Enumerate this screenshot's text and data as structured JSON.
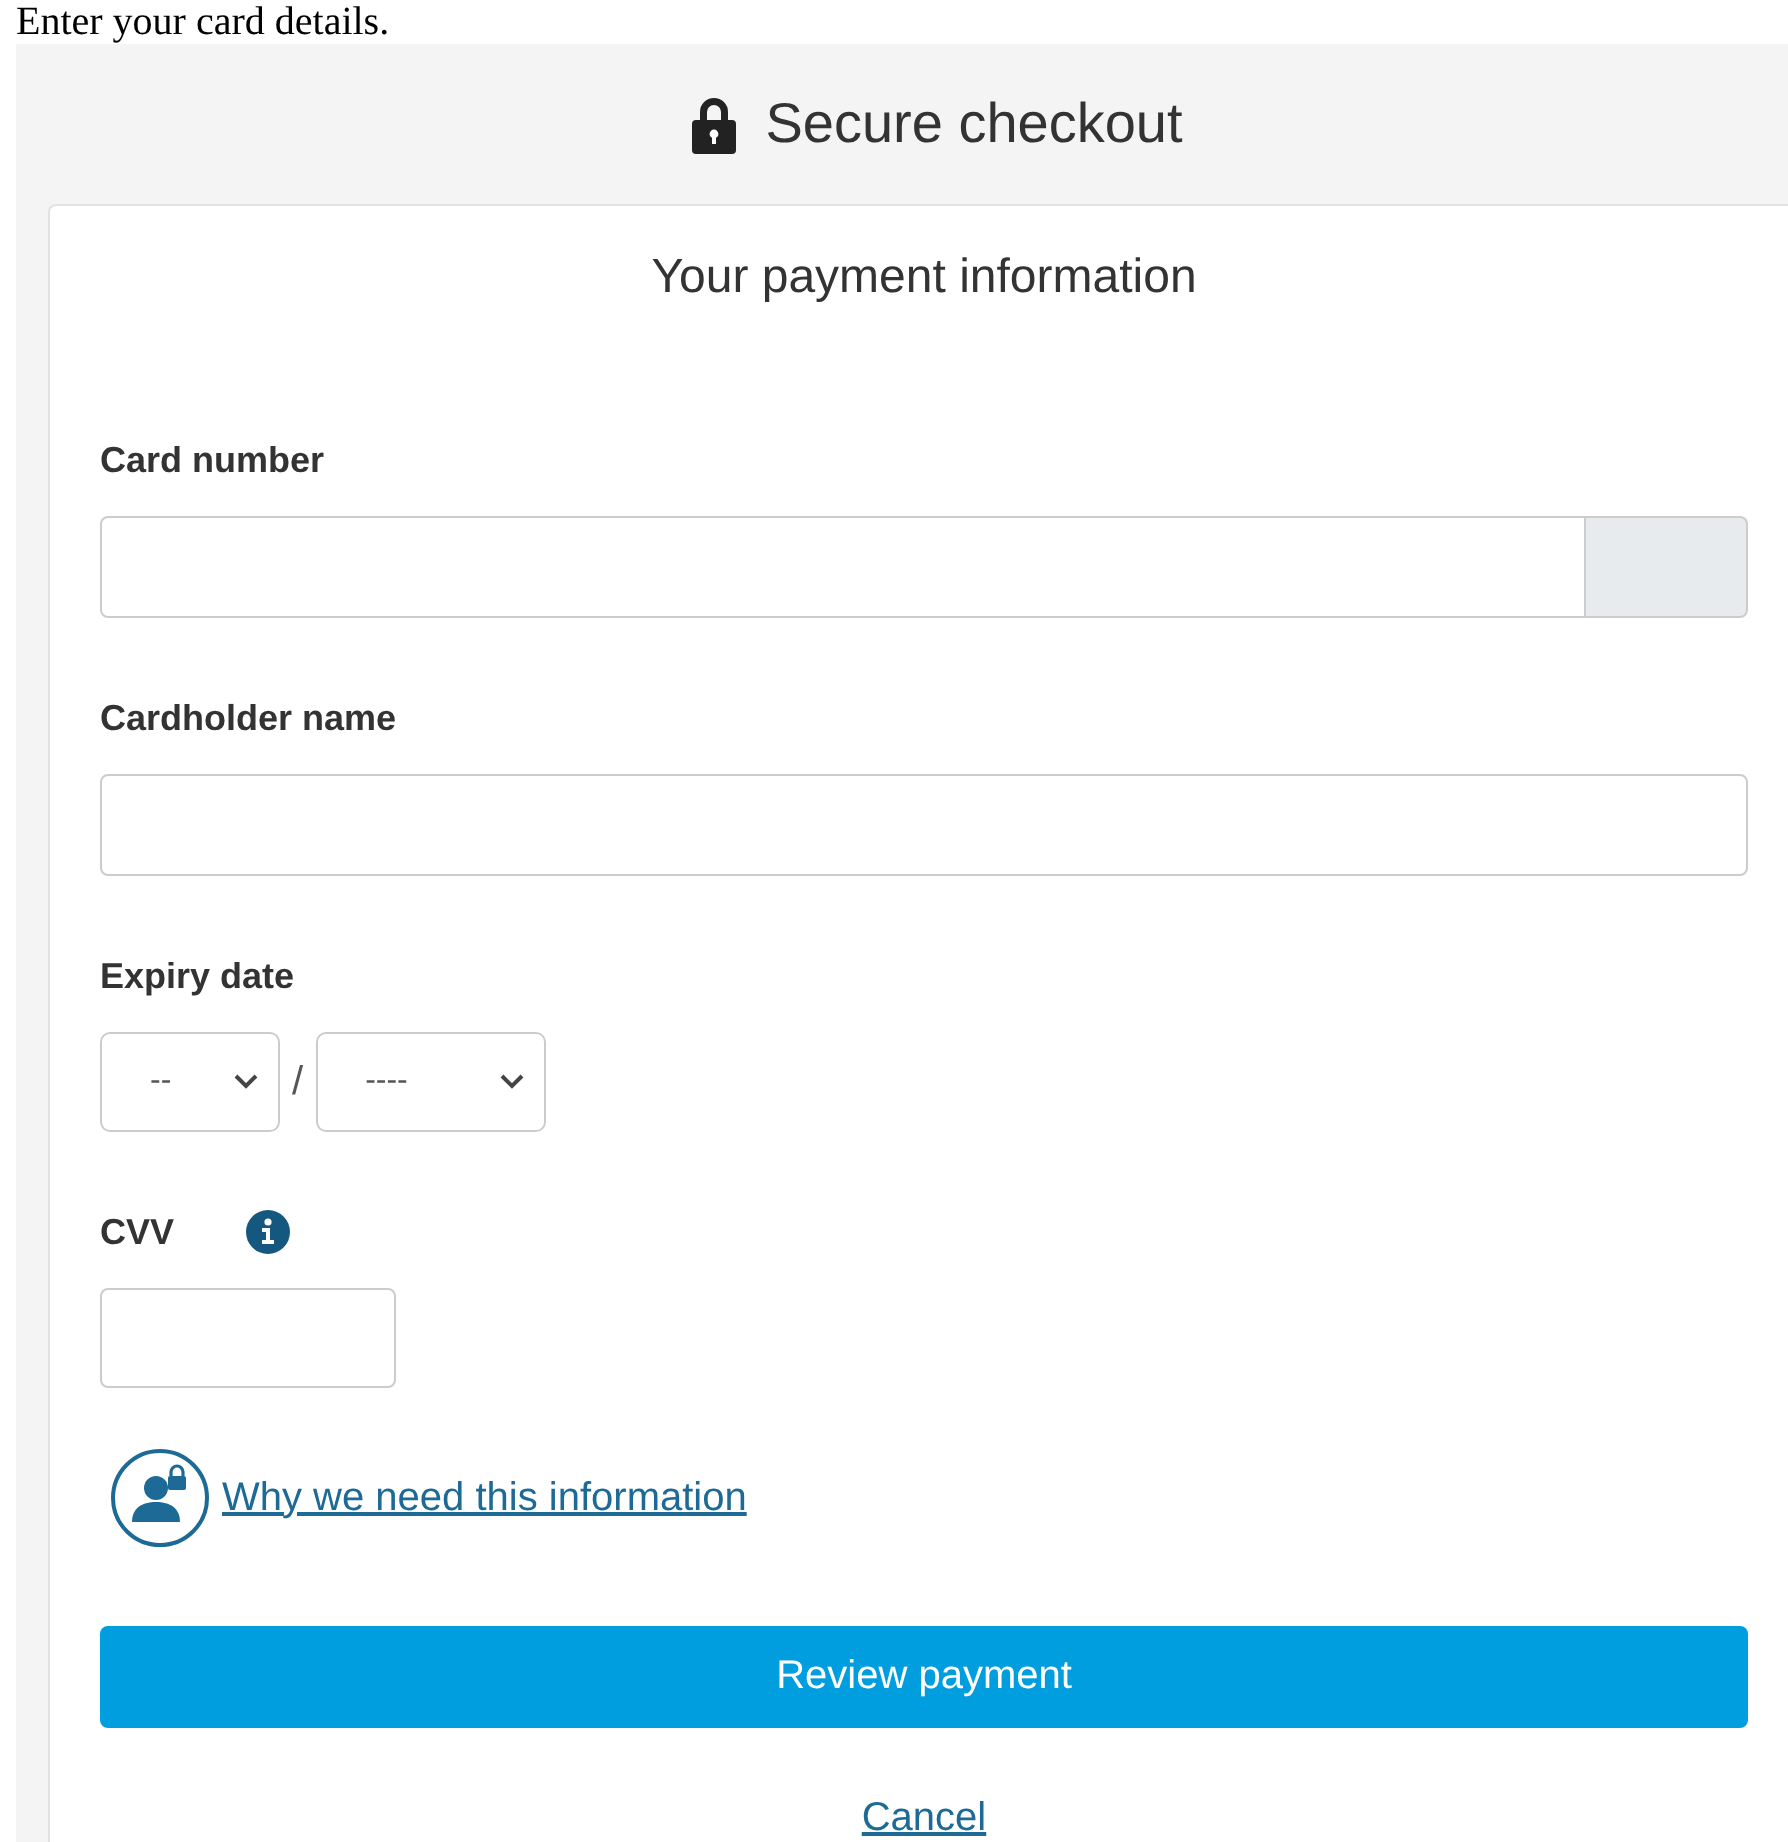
{
  "page_heading": "Enter your card details.",
  "header": {
    "title": "Secure checkout"
  },
  "card": {
    "title": "Your payment information",
    "fields": [
      {
        "kind": "text",
        "label": "Card number",
        "addon": true
      },
      {
        "kind": "text",
        "label": "Cardholder name",
        "addon": false
      },
      {
        "kind": "date",
        "label": "Expiry date",
        "parts": [
          "--",
          "----"
        ],
        "separator": "/"
      },
      {
        "kind": "cvv",
        "label": "CVV",
        "info": true
      }
    ],
    "info_link": "Why we need this information",
    "primary_button": "Review payment",
    "cancel_link": "Cancel"
  }
}
